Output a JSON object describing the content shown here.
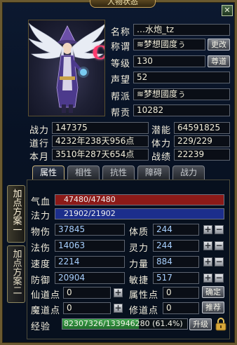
{
  "window": {
    "title": "人物状态",
    "close_label": "✕"
  },
  "profile": {
    "name_label": "名称",
    "name": "…水炮_tz",
    "title_label": "称谓",
    "title_value": "≋梦想國度ぅ",
    "title_button": "更改",
    "level_label": "等级",
    "level": "130",
    "level_button": "尊道",
    "fame_label": "声望",
    "fame": "52",
    "guild_label": "帮派",
    "guild": "≋梦想國度ぅ",
    "contribution_label": "帮贡",
    "contribution": "10282"
  },
  "stats": {
    "power_label": "战力",
    "power": "147375",
    "potential_label": "潜能",
    "potential": "64591825",
    "dao_label": "道行",
    "dao": "4232年238天956点",
    "stamina_label": "体力",
    "stamina": "229/229",
    "month_label": "本月",
    "month": "3510年287天654点",
    "merit_label": "战绩",
    "merit": "22239"
  },
  "tabs": [
    {
      "label": "属性",
      "active": true
    },
    {
      "label": "相性",
      "active": false
    },
    {
      "label": "抗性",
      "active": false
    },
    {
      "label": "障碍",
      "active": false
    },
    {
      "label": "战力",
      "active": false
    }
  ],
  "side_tabs": [
    {
      "label": "加点方案一",
      "active": true
    },
    {
      "label": "加点方案二",
      "active": false
    }
  ],
  "bars": {
    "hp_label": "气血",
    "hp": "47480/47480",
    "hp_fill": 1.0,
    "hp_color": "#8c1a18",
    "mp_label": "法力",
    "mp": "21902/21902",
    "mp_fill": 1.0,
    "mp_color": "#1c2e8c"
  },
  "attributes": {
    "phys_attack_label": "物伤",
    "phys_attack": "37845",
    "constitution_label": "体质",
    "constitution": "244",
    "magic_attack_label": "法伤",
    "magic_attack": "14063",
    "spirit_label": "灵力",
    "spirit": "244",
    "speed_label": "速度",
    "speed": "2214",
    "strength_label": "力量",
    "strength": "884",
    "defense_label": "防御",
    "defense": "20904",
    "agility_label": "敏捷",
    "agility": "517",
    "plus": "+",
    "minus": "−"
  },
  "points": {
    "immortal_label": "仙道点",
    "immortal": "0",
    "attr_points_label": "属性点",
    "attr_points": "0",
    "confirm_button": "确定",
    "demon_label": "魔道点",
    "demon": "0",
    "cultivation_label": "修道点",
    "cultivation": "0",
    "recommend_button": "推荐"
  },
  "experience": {
    "label": "经验",
    "text": "82307326/133946280 (61.4%)",
    "fill": 0.614,
    "upgrade_button": "升级"
  },
  "icons": {
    "close": "close-icon",
    "lock": "lock-icon",
    "emblem_text": "C",
    "wings": "wings-icon"
  }
}
